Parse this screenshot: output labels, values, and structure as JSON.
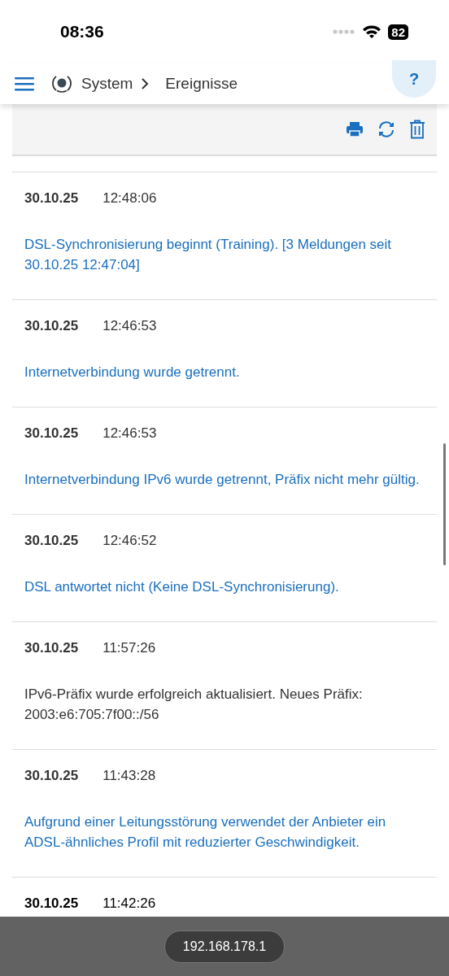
{
  "status_bar": {
    "time": "08:36",
    "battery": "82"
  },
  "header": {
    "breadcrumb": [
      "System",
      "Ereignisse"
    ],
    "help": "?"
  },
  "events": [
    {
      "date": "30.10.25",
      "time": "12:48:06",
      "message": "DSL-Synchronisierung beginnt (Training). [3 Meldungen seit 30.10.25 12:47:04]",
      "kind": "link"
    },
    {
      "date": "30.10.25",
      "time": "12:46:53",
      "message": "Internetverbindung wurde getrennt.",
      "kind": "link"
    },
    {
      "date": "30.10.25",
      "time": "12:46:53",
      "message": "Internetverbindung IPv6 wurde getrennt, Präfix nicht mehr gültig.",
      "kind": "link"
    },
    {
      "date": "30.10.25",
      "time": "12:46:52",
      "message": "DSL antwortet nicht (Keine DSL-Synchronisierung).",
      "kind": "link"
    },
    {
      "date": "30.10.25",
      "time": "11:57:26",
      "message": "IPv6-Präfix wurde erfolgreich aktualisiert. Neues Präfix: 2003:e6:705:7f00::/56",
      "kind": "plain"
    },
    {
      "date": "30.10.25",
      "time": "11:43:28",
      "message": "Aufgrund einer Leitungsstörung verwendet der Anbieter ein ADSL-ähnliches Profil mit reduzierter Geschwindigkeit.",
      "kind": "link"
    },
    {
      "date": "30.10.25",
      "time": "11:42:26"
    }
  ],
  "browser_bar": {
    "address": "192.168.178.1"
  }
}
